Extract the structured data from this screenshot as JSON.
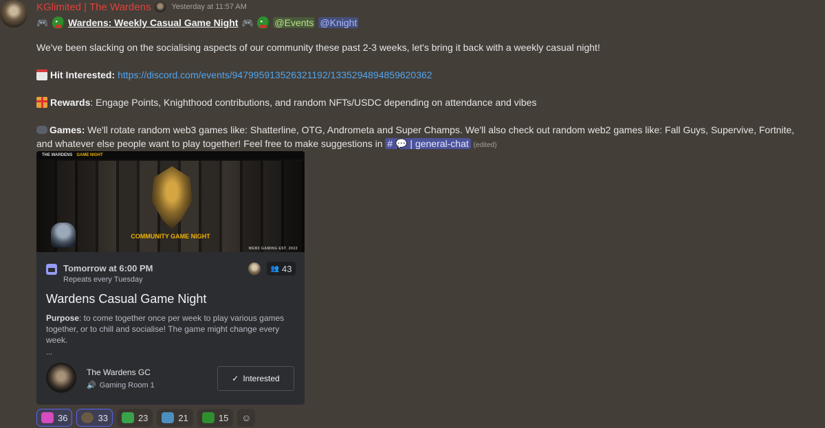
{
  "message": {
    "username": "KGlimited | The Wardens",
    "timestamp": "Yesterday at 11:57 AM",
    "title": "Wardens: Weekly Casual Game Night",
    "mention_events": "@Events",
    "mention_knight": "@Knight",
    "intro": "We've been slacking on the socialising aspects of our community these past 2-3 weeks, let's bring it back with a weekly casual night!",
    "interested_label": "Hit Interested:",
    "event_url": "https://discord.com/events/947995913526321192/1335294894859620362",
    "rewards_label": "Rewards",
    "rewards_text": ": Engage Points, Knighthood contributions, and random NFTs/USDC depending on attendance and vibes",
    "games_label": "Games:",
    "games_text": " We'll rotate random web3 games like: Shatterline, OTG, Andrometa and Super Champs. We'll also check out random web2 games like: Fall Guys, Supervive, Fortnite, and whatever else people want to play together! Feel free to make suggestions in",
    "channel": "# 💬 | general-chat",
    "edited": "(edited)"
  },
  "banner": {
    "brand": "THE WARDENS",
    "section": "GAME NIGHT",
    "headline": "COMMUNITY GAME NIGHT",
    "footer": "WEB3 GAMING    EST. 2022"
  },
  "event": {
    "when": "Tomorrow at 6:00 PM",
    "repeats": "Repeats every Tuesday",
    "count": "43",
    "title": "Wardens Casual Game Night",
    "purpose_label": "Purpose",
    "purpose_text": ": to come together once per week to play various games together, or to chill and socialise! The game might change every week.",
    "ellipsis": "...",
    "server": "The Wardens GC",
    "room": "Gaming Room 1",
    "button": "Interested"
  },
  "reactions": [
    {
      "icon": "gamepad-icon",
      "count": "36",
      "active": true,
      "color": "#d64bbf"
    },
    {
      "icon": "warden-helmet-icon",
      "count": "33",
      "active": true,
      "color": "#6b5a44"
    },
    {
      "icon": "pepe-sick-icon",
      "count": "23",
      "active": false,
      "color": "#3aa34a"
    },
    {
      "icon": "pepe-robot-icon",
      "count": "21",
      "active": false,
      "color": "#4b8fbf"
    },
    {
      "icon": "pepe-icon",
      "count": "15",
      "active": false,
      "color": "#2f8f2f"
    }
  ]
}
